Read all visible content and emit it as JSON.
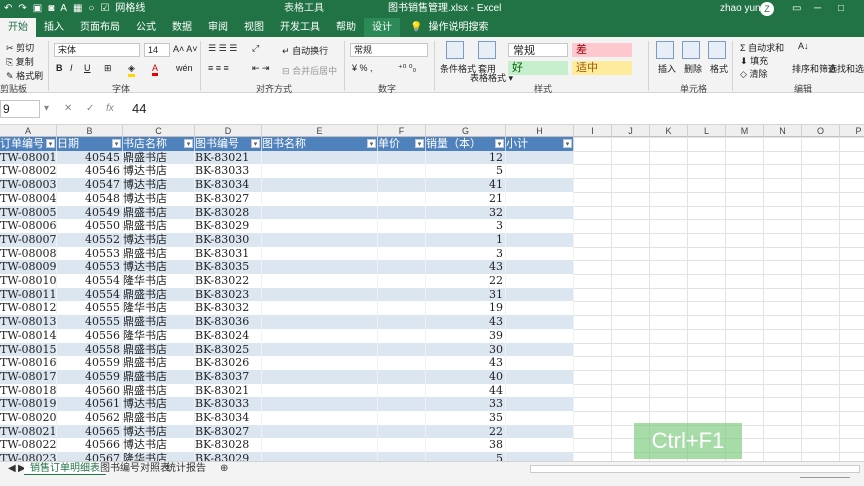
{
  "titlebar": {
    "tool_title": "表格工具",
    "doc_title": "图书销售管理.xlsx - Excel",
    "user": "zhao yun",
    "gridlines_label": "网格线",
    "avatar": "Z"
  },
  "tabs": [
    "开始",
    "插入",
    "页面布局",
    "公式",
    "数据",
    "审阅",
    "视图",
    "开发工具",
    "帮助",
    "设计"
  ],
  "tellme": "操作说明搜索",
  "ribbon": {
    "clipboard": {
      "cut": "剪切",
      "copy": "复制",
      "format_painter": "格式刷",
      "label": "剪贴板"
    },
    "font": {
      "name": "宋体",
      "size": "14",
      "bold": "B",
      "italic": "I",
      "underline": "U",
      "label": "字体"
    },
    "align": {
      "wrap": "自动换行",
      "merge": "合并后居中",
      "label": "对齐方式"
    },
    "number": {
      "format": "常规",
      "label": "数字"
    },
    "styles": {
      "cond": "条件格式",
      "table": "套用\n表格格式",
      "normal": "常规",
      "bad": "差",
      "good": "好",
      "neutral": "适中",
      "label": "样式"
    },
    "cells": {
      "insert": "插入",
      "delete": "删除",
      "format": "格式",
      "label": "单元格"
    },
    "editing": {
      "autosum": "自动求和",
      "fill": "填充",
      "clear": "清除",
      "sort": "排序和筛选",
      "find": "查找和选择",
      "label": "编辑"
    }
  },
  "formula_bar": {
    "name_box": "9",
    "value": "44"
  },
  "columns": [
    "A",
    "B",
    "C",
    "D",
    "E",
    "F",
    "G",
    "H",
    "I",
    "J",
    "K",
    "L",
    "M",
    "N",
    "O",
    "P"
  ],
  "table": {
    "headers": [
      "订单编号",
      "日期",
      "书店名称",
      "图书编号",
      "图书名称",
      "单价",
      "销量（本）",
      "小计"
    ],
    "rows": [
      [
        "TW-08001",
        "40545",
        "鼎盛书店",
        "BK-83021",
        "",
        "",
        "12",
        ""
      ],
      [
        "TW-08002",
        "40546",
        "博达书店",
        "BK-83033",
        "",
        "",
        "5",
        ""
      ],
      [
        "TW-08003",
        "40547",
        "博达书店",
        "BK-83034",
        "",
        "",
        "41",
        ""
      ],
      [
        "TW-08004",
        "40548",
        "博达书店",
        "BK-83027",
        "",
        "",
        "21",
        ""
      ],
      [
        "TW-08005",
        "40549",
        "鼎盛书店",
        "BK-83028",
        "",
        "",
        "32",
        ""
      ],
      [
        "TW-08006",
        "40550",
        "鼎盛书店",
        "BK-83029",
        "",
        "",
        "3",
        ""
      ],
      [
        "TW-08007",
        "40552",
        "博达书店",
        "BK-83030",
        "",
        "",
        "1",
        ""
      ],
      [
        "TW-08008",
        "40553",
        "鼎盛书店",
        "BK-83031",
        "",
        "",
        "3",
        ""
      ],
      [
        "TW-08009",
        "40553",
        "博达书店",
        "BK-83035",
        "",
        "",
        "43",
        ""
      ],
      [
        "TW-08010",
        "40554",
        "隆华书店",
        "BK-83022",
        "",
        "",
        "22",
        ""
      ],
      [
        "TW-08011",
        "40554",
        "鼎盛书店",
        "BK-83023",
        "",
        "",
        "31",
        ""
      ],
      [
        "TW-08012",
        "40555",
        "隆华书店",
        "BK-83032",
        "",
        "",
        "19",
        ""
      ],
      [
        "TW-08013",
        "40555",
        "鼎盛书店",
        "BK-83036",
        "",
        "",
        "43",
        ""
      ],
      [
        "TW-08014",
        "40556",
        "隆华书店",
        "BK-83024",
        "",
        "",
        "39",
        ""
      ],
      [
        "TW-08015",
        "40558",
        "鼎盛书店",
        "BK-83025",
        "",
        "",
        "30",
        ""
      ],
      [
        "TW-08016",
        "40559",
        "鼎盛书店",
        "BK-83026",
        "",
        "",
        "43",
        ""
      ],
      [
        "TW-08017",
        "40559",
        "鼎盛书店",
        "BK-83037",
        "",
        "",
        "40",
        ""
      ],
      [
        "TW-08018",
        "40560",
        "鼎盛书店",
        "BK-83021",
        "",
        "",
        "44",
        ""
      ],
      [
        "TW-08019",
        "40561",
        "博达书店",
        "BK-83033",
        "",
        "",
        "33",
        ""
      ],
      [
        "TW-08020",
        "40562",
        "鼎盛书店",
        "BK-83034",
        "",
        "",
        "35",
        ""
      ],
      [
        "TW-08021",
        "40565",
        "博达书店",
        "BK-83027",
        "",
        "",
        "22",
        ""
      ],
      [
        "TW-08022",
        "40566",
        "博达书店",
        "BK-83028",
        "",
        "",
        "38",
        ""
      ],
      [
        "TW-08023",
        "40567",
        "隆华书店",
        "BK-83029",
        "",
        "",
        "5",
        ""
      ]
    ]
  },
  "sheets": [
    "销售订单明细表",
    "图书编号对照表",
    "统计报告"
  ],
  "overlay": "Ctrl+F1"
}
